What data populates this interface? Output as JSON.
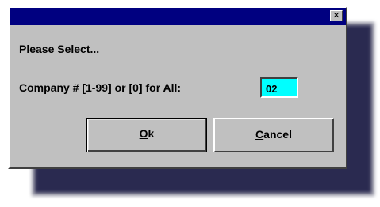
{
  "dialog": {
    "title": "",
    "close_glyph": "✕",
    "prompt": "Please Select...",
    "field_label": "Company # [1-99] or [0] for All:",
    "company_value": "02",
    "buttons": {
      "ok": {
        "mnemonic": "O",
        "rest": "k"
      },
      "cancel": {
        "mnemonic": "C",
        "rest": "ancel"
      }
    },
    "colors": {
      "titlebar": "#000080",
      "face": "#c0c0c0",
      "input_bg": "#00ffff"
    },
    "icons": {
      "close": "close-icon"
    }
  }
}
